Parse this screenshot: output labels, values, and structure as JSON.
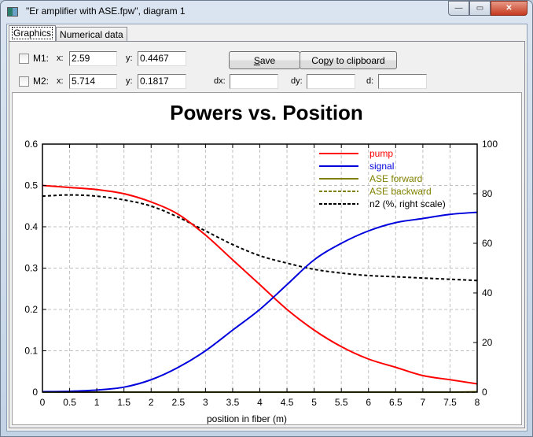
{
  "window": {
    "title": "\"Er amplifier with ASE.fpw\", diagram 1",
    "controls": {
      "minimize": "—",
      "maximize": "▭",
      "close": "✕"
    }
  },
  "tabs": [
    {
      "label": "Graphics",
      "active": true
    },
    {
      "label": "Numerical data",
      "active": false
    }
  ],
  "markers": {
    "m1": {
      "label": "M1:",
      "checked": false,
      "x_label": "x:",
      "x": "2.59",
      "y_label": "y:",
      "y": "0.4467"
    },
    "m2": {
      "label": "M2:",
      "checked": false,
      "x_label": "x:",
      "x": "5.714",
      "y_label": "y:",
      "y": "0.1817"
    },
    "dx_label": "dx:",
    "dx": "",
    "dy_label": "dy:",
    "dy": "",
    "d_label": "d:",
    "d": ""
  },
  "buttons": {
    "save_prefix": "",
    "save_mnemonic": "S",
    "save_rest": "ave",
    "copy_prefix": "Co",
    "copy_mnemonic": "p",
    "copy_rest": "y to clipboard"
  },
  "colors": {
    "pump": "#ff0000",
    "signal": "#0000dd",
    "ase_forward": "#808000",
    "ase_backward": "#808000",
    "n2": "#000000",
    "grid": "#c0c0c0"
  },
  "chart_data": {
    "type": "line",
    "title": "Powers vs. Position",
    "xlabel": "position in fiber (m)",
    "ylabel": "",
    "y2label": "",
    "xlim": [
      0,
      8
    ],
    "ylim": [
      0,
      0.6
    ],
    "y2lim": [
      0,
      100
    ],
    "grid": true,
    "legend_position": "top-right",
    "x_ticks": [
      "0",
      "0.5",
      "1",
      "1.5",
      "2",
      "2.5",
      "3",
      "3.5",
      "4",
      "4.5",
      "5",
      "5.5",
      "6",
      "6.5",
      "7",
      "7.5",
      "8"
    ],
    "y_ticks": [
      "0",
      "0.1",
      "0.2",
      "0.3",
      "0.4",
      "0.5",
      "0.6"
    ],
    "y2_ticks": [
      "0",
      "20",
      "40",
      "60",
      "80",
      "100"
    ],
    "x": [
      0,
      0.5,
      1,
      1.5,
      2,
      2.5,
      3,
      3.5,
      4,
      4.5,
      5,
      5.5,
      6,
      6.5,
      7,
      7.5,
      8
    ],
    "series": [
      {
        "name": "pump",
        "axis": "left",
        "style": "solid",
        "color": "#ff0000",
        "values": [
          0.5,
          0.495,
          0.49,
          0.48,
          0.46,
          0.43,
          0.38,
          0.32,
          0.26,
          0.2,
          0.15,
          0.11,
          0.08,
          0.06,
          0.04,
          0.03,
          0.02
        ]
      },
      {
        "name": "signal",
        "axis": "left",
        "style": "solid",
        "color": "#0000dd",
        "values": [
          0.001,
          0.002,
          0.005,
          0.012,
          0.03,
          0.06,
          0.1,
          0.15,
          0.2,
          0.26,
          0.32,
          0.36,
          0.39,
          0.41,
          0.42,
          0.43,
          0.435
        ]
      },
      {
        "name": "ASE forward",
        "axis": "left",
        "style": "solid",
        "color": "#808000",
        "values": [
          0,
          0,
          0,
          0,
          0,
          0,
          0,
          0,
          0,
          0,
          0,
          0,
          0,
          0,
          0,
          0,
          0.001
        ]
      },
      {
        "name": "ASE backward",
        "axis": "left",
        "style": "dashed",
        "color": "#808000",
        "values": [
          0.001,
          0,
          0,
          0,
          0,
          0,
          0,
          0,
          0,
          0,
          0,
          0,
          0,
          0,
          0,
          0,
          0
        ]
      },
      {
        "name": "n2 (%, right scale)",
        "axis": "right",
        "style": "dashed",
        "color": "#000000",
        "values": [
          79,
          79.5,
          79,
          77.5,
          75,
          70.5,
          65,
          59.5,
          55,
          52,
          49.5,
          48,
          47,
          46.5,
          46,
          45.5,
          45
        ]
      }
    ]
  }
}
